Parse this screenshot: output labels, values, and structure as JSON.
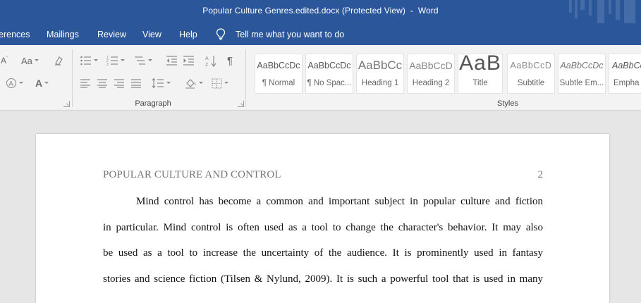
{
  "window": {
    "title": "Popular Culture Genres.edited.docx (Protected View)  -  Word"
  },
  "ribbon_tabs": [
    {
      "label": "erences"
    },
    {
      "label": "Mailings"
    },
    {
      "label": "Review"
    },
    {
      "label": "View"
    },
    {
      "label": "Help"
    }
  ],
  "tell_me": {
    "label": "Tell me what you want to do"
  },
  "font_group": {
    "change_case": "Aa"
  },
  "paragraph_group": {
    "label": "Paragraph"
  },
  "styles_group": {
    "label": "Styles",
    "items": [
      {
        "preview": "AaBbCcDc",
        "name": "¶ Normal"
      },
      {
        "preview": "AaBbCcDc",
        "name": "¶ No Spac..."
      },
      {
        "preview": "AaBbCc",
        "name": "Heading 1"
      },
      {
        "preview": "AaBbCcD",
        "name": "Heading 2"
      },
      {
        "preview": "AaB",
        "name": "Title"
      },
      {
        "preview": "AaBbCcD",
        "name": "Subtitle"
      },
      {
        "preview": "AaBbCcDc",
        "name": "Subtle Em..."
      },
      {
        "preview": "AaBbCcDc",
        "name": "Empha"
      }
    ]
  },
  "document": {
    "running_head": "POPULAR CULTURE AND CONTROL",
    "page_number": "2",
    "lines": [
      "Mind control has become a common and important subject in popular culture and fiction",
      "in particular.  Mind control is often used as a tool to change the character's behavior.  It may also",
      "be used as a tool to increase the uncertainty of the audience. It is prominently used in fantasy",
      "stories and science fiction (Tilsen & Nylund, 2009).  It is such a powerful tool that is used in many"
    ]
  },
  "colors": {
    "title_bar": "#2b579a",
    "ribbon": "#f3f3f3",
    "document_background": "#e6e6e6",
    "page": "#ffffff"
  }
}
